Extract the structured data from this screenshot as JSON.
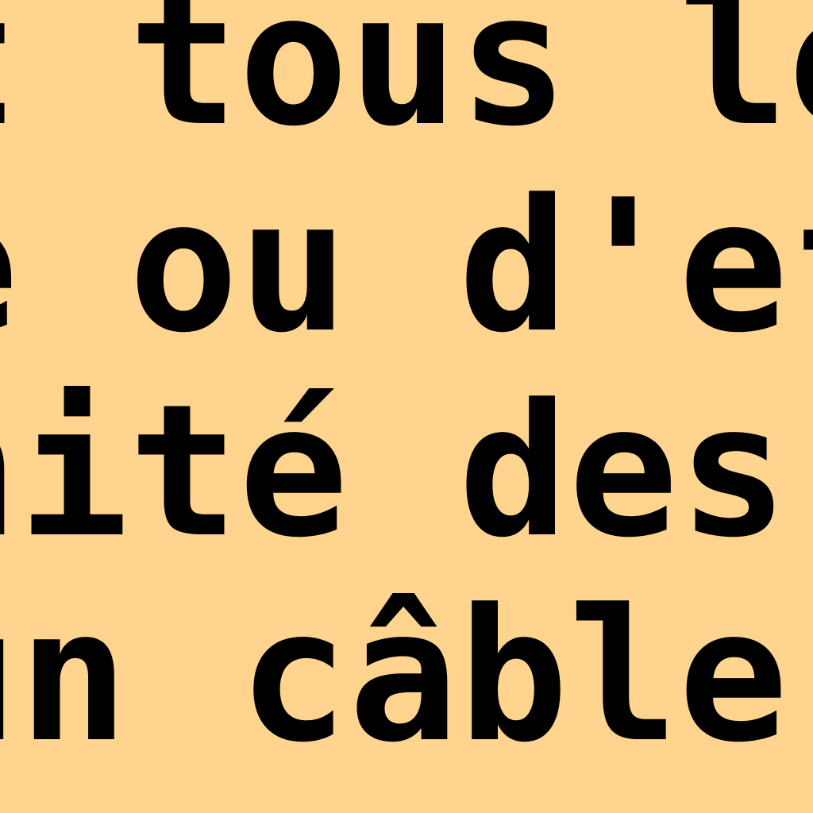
{
  "text_block": {
    "lines": [
      "t tous les",
      "e ou d'ef",
      "nité des",
      "un câble"
    ]
  },
  "colors": {
    "background": "#FFD48E",
    "text": "#000000"
  }
}
